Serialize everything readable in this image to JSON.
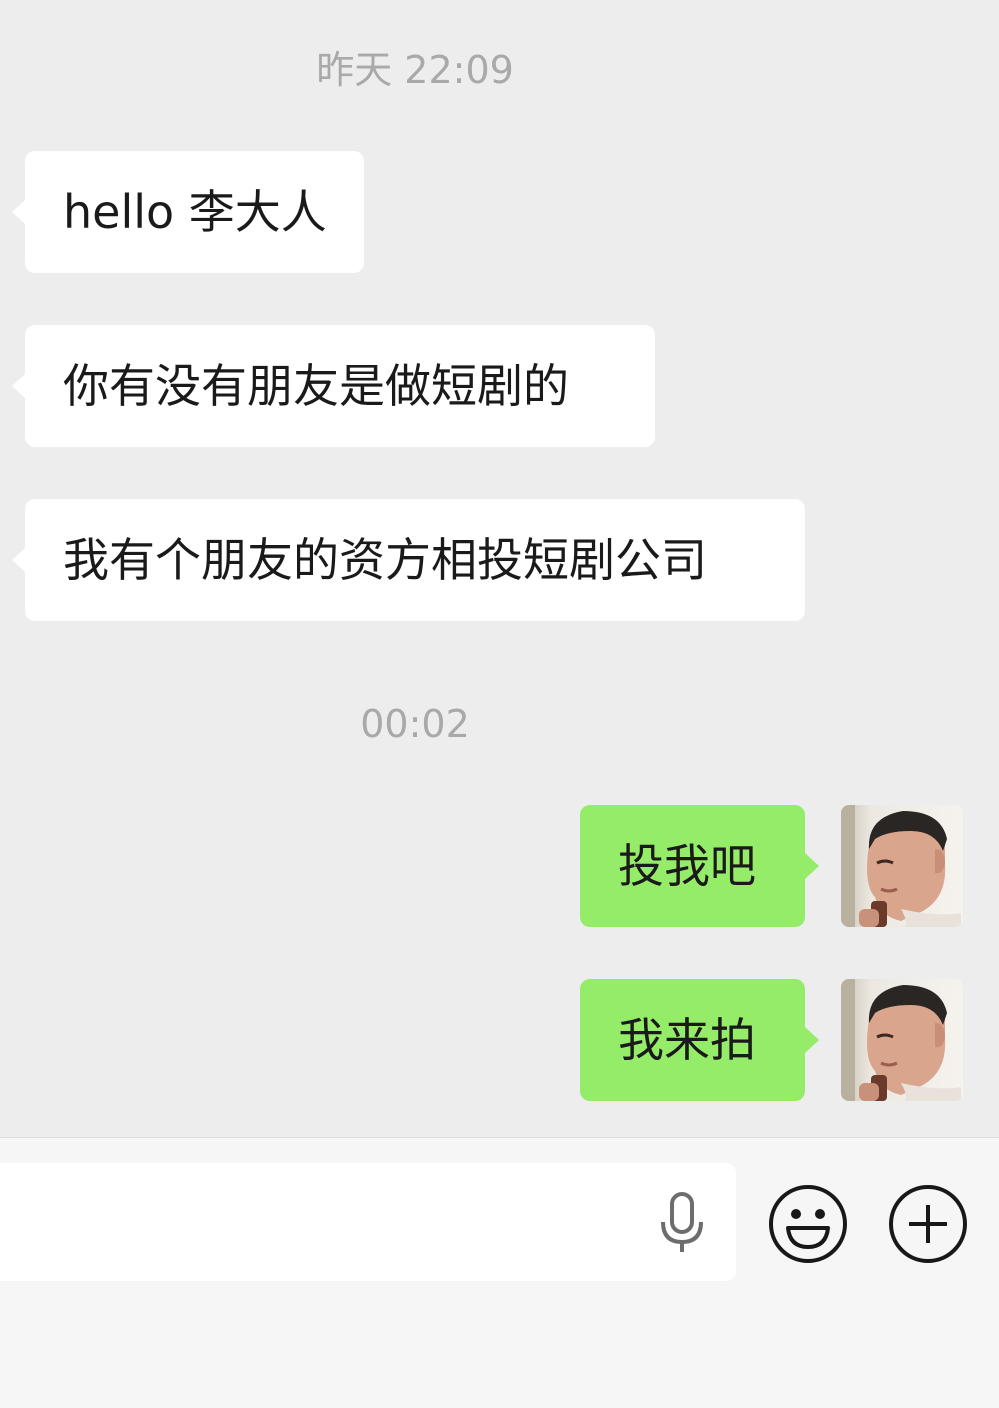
{
  "timestamps": [
    "昨天 22:09",
    "00:02"
  ],
  "messages": [
    {
      "direction": "in",
      "text": "hello 李大人"
    },
    {
      "direction": "in",
      "text": "你有没有朋友是做短剧的"
    },
    {
      "direction": "in",
      "text": "我有个朋友的资方相投短剧公司"
    },
    {
      "direction": "out",
      "text": "投我吧"
    },
    {
      "direction": "out",
      "text": "我来拍"
    }
  ],
  "input_bar": {
    "input_value": "",
    "icons": [
      "microphone-icon",
      "emoji-smile-icon",
      "plus-circle-icon"
    ]
  },
  "colors": {
    "chat_background": "#ededed",
    "incoming_bubble": "#ffffff",
    "outgoing_bubble": "#95ec69",
    "timestamp_text": "#a9a9a9",
    "input_bar_background": "#f6f6f6"
  }
}
